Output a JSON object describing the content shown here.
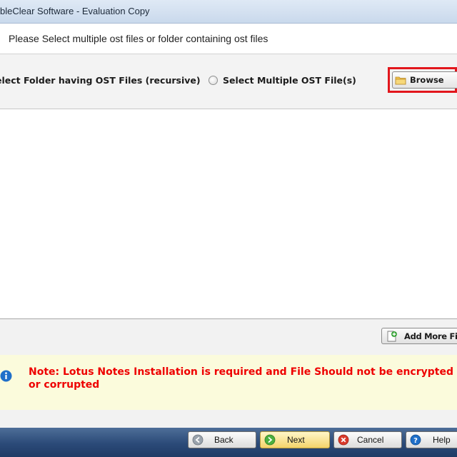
{
  "window": {
    "title": "bleClear Software - Evaluation Copy"
  },
  "instruction": "Please Select multiple ost files or folder containing ost files",
  "options": {
    "folder_option_label": "elect Folder having OST Files (recursive)",
    "files_option_label": "Select Multiple OST File(s)"
  },
  "browse_button": {
    "label": "Browse",
    "icon": "folder-icon"
  },
  "file_list": {
    "items": []
  },
  "add_more_button": {
    "label": "Add More Files",
    "icon": "add-file-icon"
  },
  "note": {
    "icon": "info-icon",
    "text": "Note: Lotus Notes Installation is required and File Should not be encrypted or corrupted",
    "color": "#ee0000"
  },
  "footer": {
    "back_label": "Back",
    "next_label": "Next",
    "cancel_label": "Cancel",
    "help_label": "Help"
  },
  "colors": {
    "highlight": "#e2161c",
    "bottom_bar": "#2b4a78",
    "note_background": "#fbfbdc"
  }
}
